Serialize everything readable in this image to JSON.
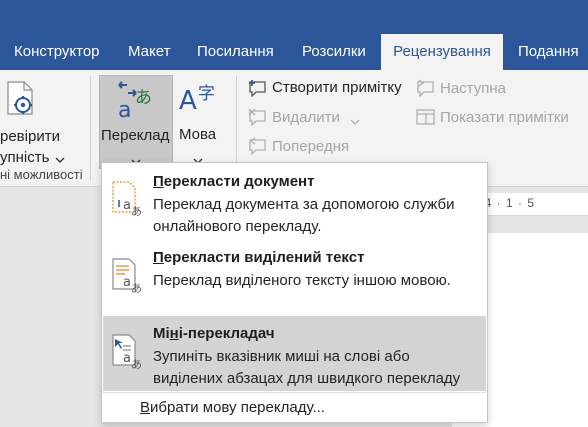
{
  "tabs": [
    {
      "label": "Конструктор"
    },
    {
      "label": "Макет"
    },
    {
      "label": "Посилання"
    },
    {
      "label": "Розсилки"
    },
    {
      "label": "Рецензування"
    },
    {
      "label": "Подання"
    }
  ],
  "ribbon": {
    "spelling_line1": "ревірити",
    "spelling_line2": "упність",
    "group_label_accessibility": "ні можливості",
    "translate_label": "Переклад",
    "language_label": "Мова",
    "new_comment": "Створити примітку",
    "delete": "Видалити",
    "previous": "Попередня",
    "next": "Наступна",
    "show_comments": "Показати примітки"
  },
  "ruler": {
    "text": "· 1 · 4 · 1 · 5"
  },
  "menu": {
    "items": [
      {
        "title": "Перекласти документ",
        "accel": "П",
        "title_rest": "ерекласти документ",
        "desc": "Переклад документа за допомогою служби онлайнового перекладу."
      },
      {
        "title": "Перекласти виділений текст",
        "accel": "П",
        "title_rest": "ерекласти виділений текст",
        "desc": "Переклад виділеного тексту іншою мовою."
      },
      {
        "title": "Міні-перекладач",
        "accel_pre": "Мі",
        "accel": "н",
        "title_rest": "і-перекладач",
        "desc": "Зупиніть вказівник миші на слові або виділених абзацах для швидкого перекладу"
      }
    ],
    "footer": {
      "label": "Вибрати мову перекладу...",
      "accel": "В",
      "rest": "ибрати мову перекладу..."
    }
  },
  "colors": {
    "accent": "#2b579a",
    "ribbon_bg": "#f3f3f3",
    "hover": "#d4d4d4"
  }
}
